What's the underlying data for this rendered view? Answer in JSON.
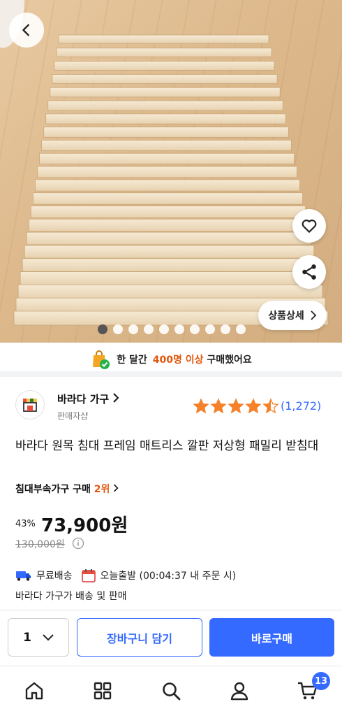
{
  "gallery": {
    "detail_label": "상품상세",
    "page_count": 10,
    "active_index": 0
  },
  "notice": {
    "prefix": "한 달간",
    "highlight": "400명 이상",
    "suffix": "구매했어요"
  },
  "seller": {
    "name": "바라다 가구",
    "subtitle": "판매자샵"
  },
  "rating": {
    "stars": 4.5,
    "review_count": "(1,272)"
  },
  "product": {
    "title": "바라다 원목 침대 프레임 매트리스 깔판 저상형 패밀리 받침대",
    "rank_label": "침대부속가구 구매",
    "rank_value": "2위",
    "discount": "43%",
    "price": "73,900원",
    "original_price": "130,000원"
  },
  "shipping": {
    "free": "무료배송",
    "today": "오늘출발 (00:04:37 내 주문 시)",
    "seller_note": "바라다 가구가 배송 및 판매"
  },
  "purchase": {
    "quantity": "1",
    "cart_label": "장바구니 담기",
    "buy_label": "바로구매"
  },
  "nav": {
    "cart_count": "13",
    "items": [
      "home-icon",
      "category-icon",
      "search-icon",
      "user-icon",
      "cart-icon"
    ]
  },
  "colors": {
    "accent": "#346aff",
    "highlight": "#e2560b",
    "star": "#f5822b"
  }
}
